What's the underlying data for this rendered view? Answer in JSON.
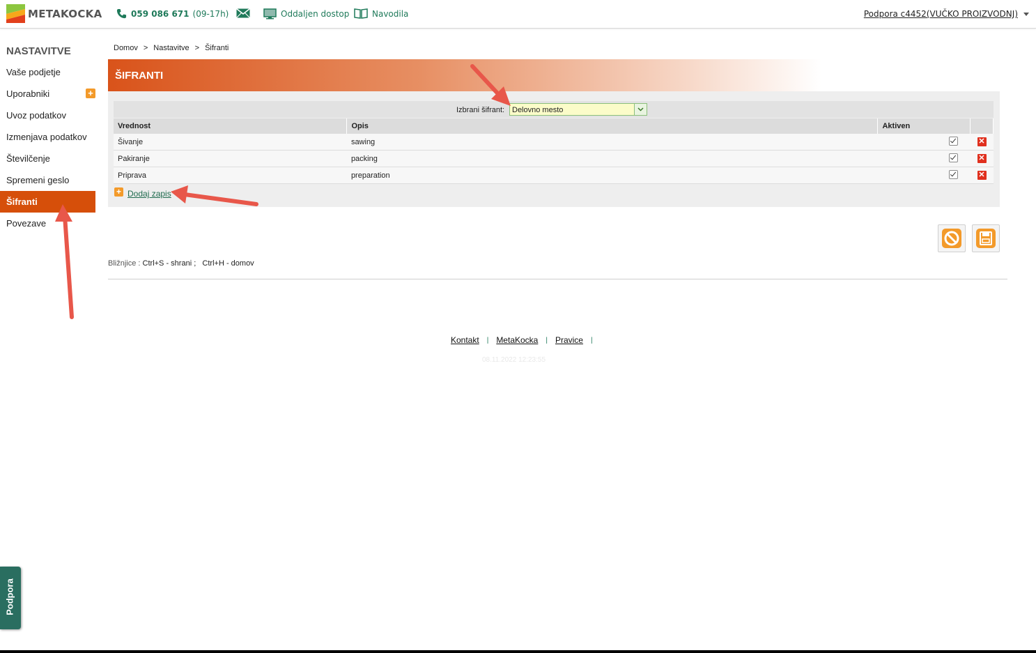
{
  "header": {
    "logo_text": "METAKOCKA",
    "phone": "059 086 671",
    "phone_hours": "(09-17h)",
    "remote_access": "Oddaljen dostop",
    "manual": "Navodila",
    "user": "Podpora c4452(VUČKO PROIZVODNJ)"
  },
  "sidebar": {
    "title": "NASTAVITVE",
    "items": [
      {
        "label": "Vaše podjetje"
      },
      {
        "label": "Uporabniki"
      },
      {
        "label": "Uvoz podatkov"
      },
      {
        "label": "Izmenjava podatkov"
      },
      {
        "label": "Številčenje"
      },
      {
        "label": "Spremeni geslo"
      },
      {
        "label": "Šifranti"
      },
      {
        "label": "Povezave"
      }
    ],
    "active_item": "Šifranti"
  },
  "breadcrumb": [
    "Domov",
    "Nastavitve",
    "Šifranti"
  ],
  "breadcrumb_sep": ">",
  "page_title": "ŠIFRANTI",
  "selector": {
    "label": "Izbrani šifrant:",
    "value": "Delovno mesto"
  },
  "table": {
    "columns": [
      "Vrednost",
      "Opis",
      "Aktiven",
      ""
    ],
    "rows": [
      {
        "vrednost": "Šivanje",
        "opis": "sawing",
        "aktiven": true
      },
      {
        "vrednost": "Pakiranje",
        "opis": "packing",
        "aktiven": true
      },
      {
        "vrednost": "Priprava",
        "opis": "preparation",
        "aktiven": true
      }
    ]
  },
  "add_record": "Dodaj zapis",
  "shortcuts": {
    "label": "Bližnjice :",
    "value": "Ctrl+S - shrani ;   Ctrl+H - domov"
  },
  "footer": {
    "links": [
      "Kontakt",
      "MetaKocka",
      "Pravice"
    ],
    "timestamp": "08.11.2022 12:23:55"
  },
  "support_tab": "Podpora",
  "colors": {
    "brand_orange": "#d64f0a",
    "brand_green": "#1f7a5a",
    "annotation_arrow": "#e8574a"
  }
}
